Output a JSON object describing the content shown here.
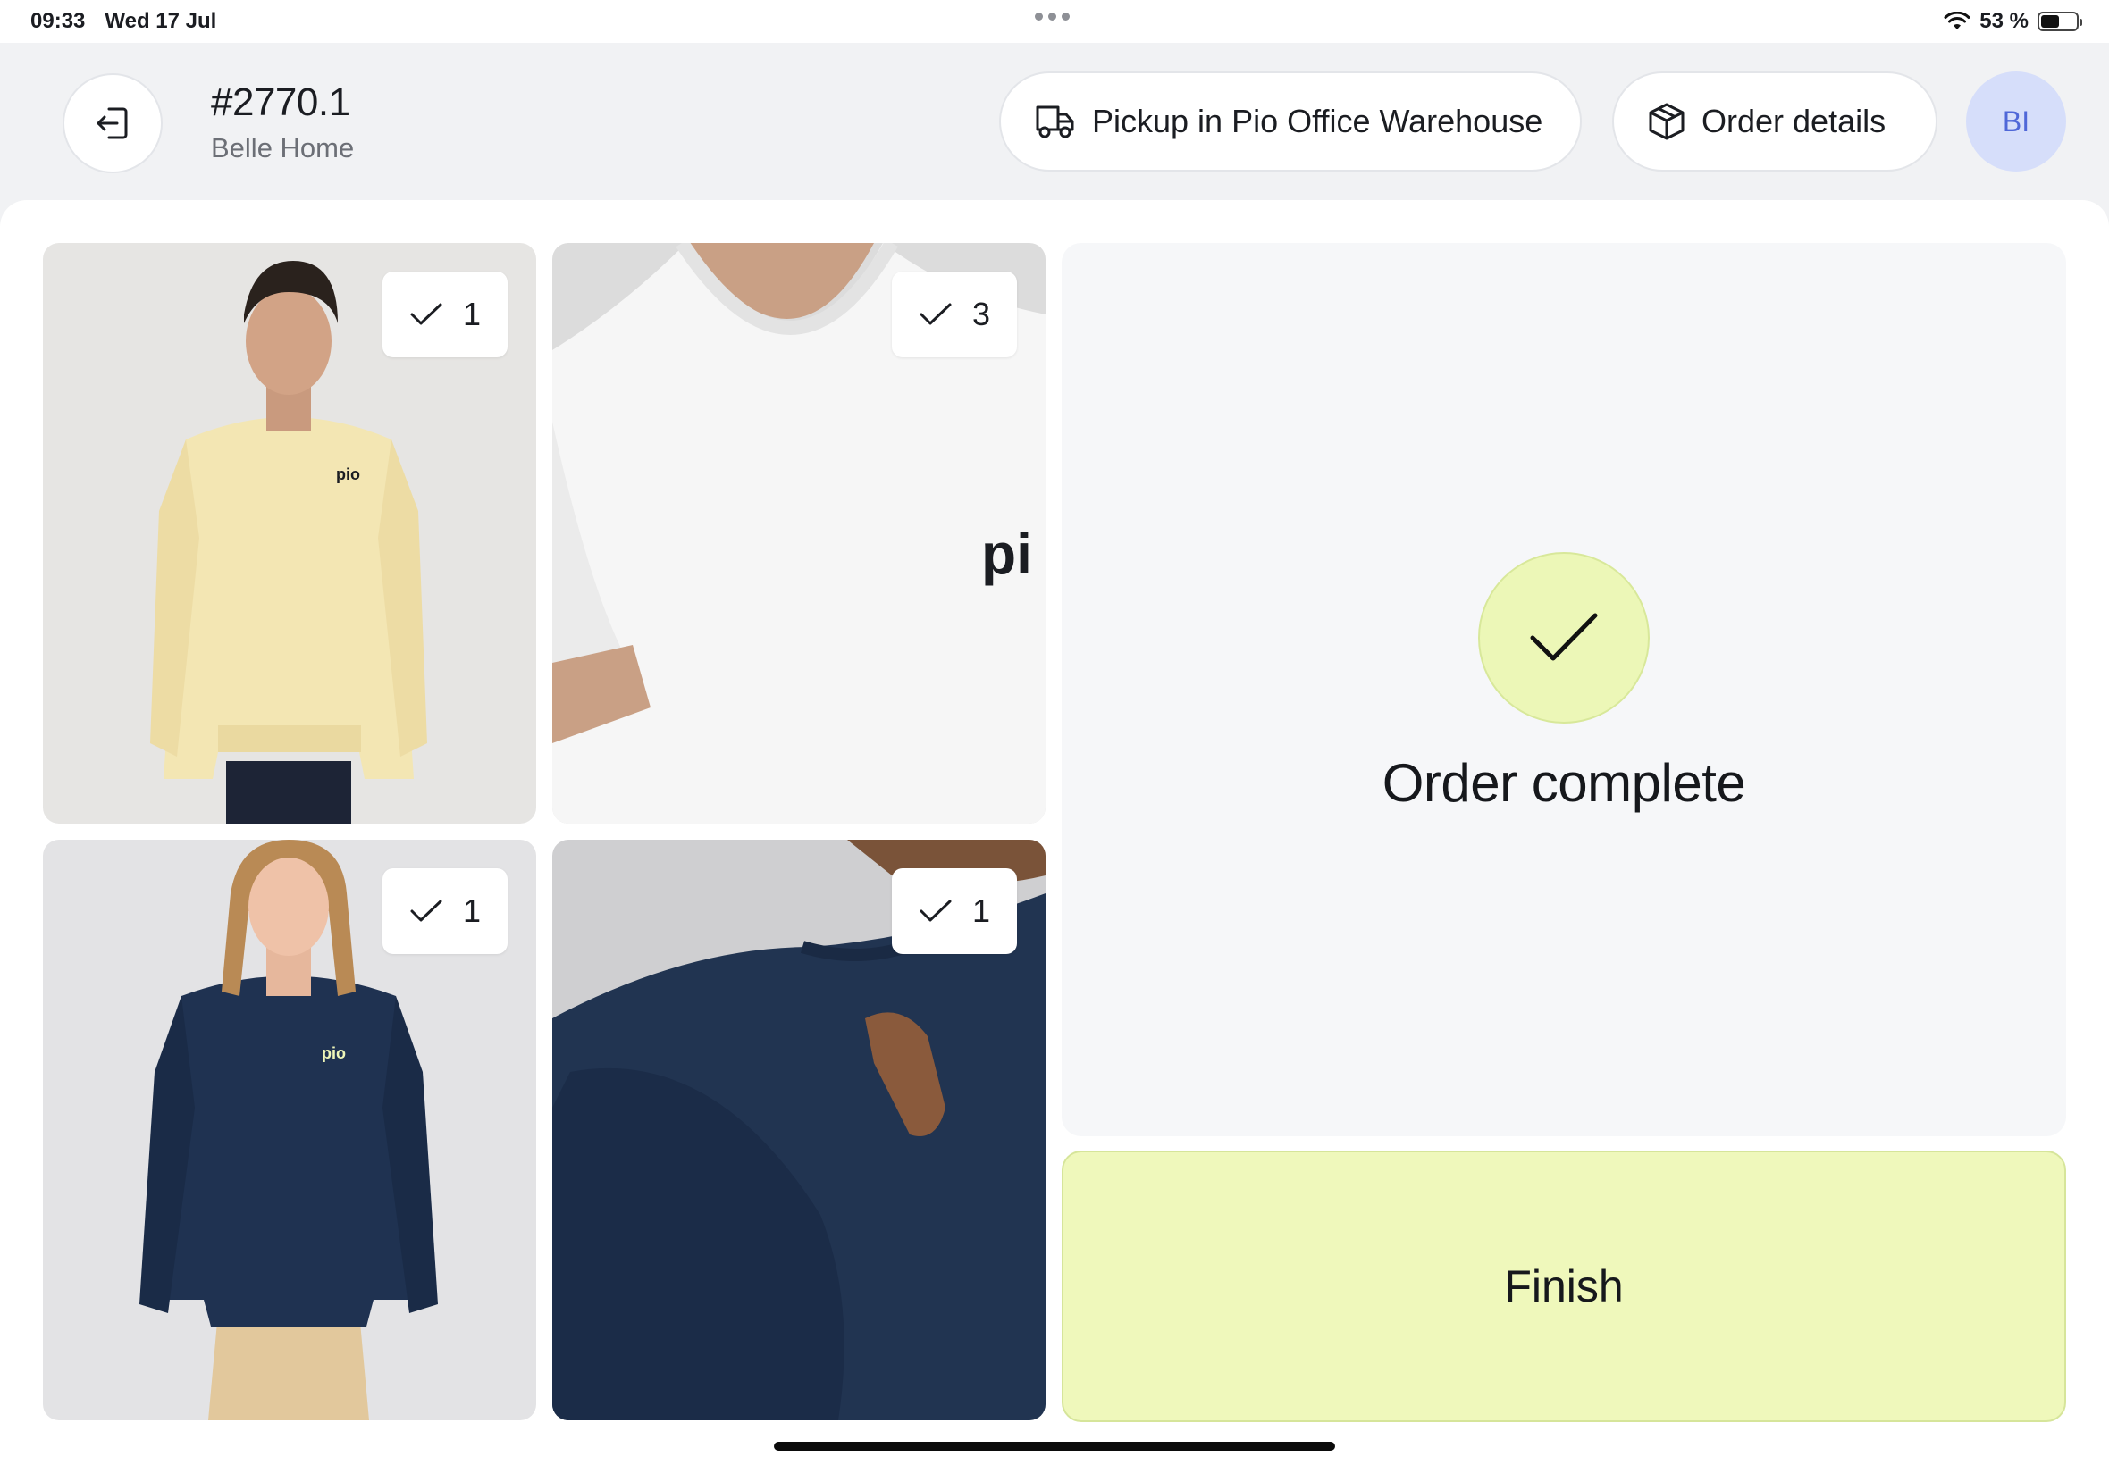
{
  "status_bar": {
    "time": "09:33",
    "date": "Wed 17 Jul",
    "battery": "53 %",
    "battery_level": 0.53
  },
  "header": {
    "back_icon": "exit-arrow-icon",
    "order_id": "#2770.1",
    "customer": "Belle Home",
    "pickup_label": "Pickup in Pio Office Warehouse",
    "pickup_icon": "truck-icon",
    "details_label": "Order details",
    "details_icon": "package-icon",
    "avatar_initials": "BI"
  },
  "items": [
    {
      "product": "yellow sweatshirt",
      "quantity": "1",
      "picked": true
    },
    {
      "product": "white t-shirt",
      "quantity": "3",
      "picked": true
    },
    {
      "product": "navy sweatshirt",
      "quantity": "1",
      "picked": true
    },
    {
      "product": "navy sweatshirt",
      "quantity": "1",
      "picked": true
    }
  ],
  "completion": {
    "icon": "check-icon",
    "message": "Order complete",
    "finish_label": "Finish"
  },
  "colors": {
    "accent_green": "#eff8bb",
    "avatar_bg": "#d6defa",
    "avatar_text": "#4f67d8"
  }
}
